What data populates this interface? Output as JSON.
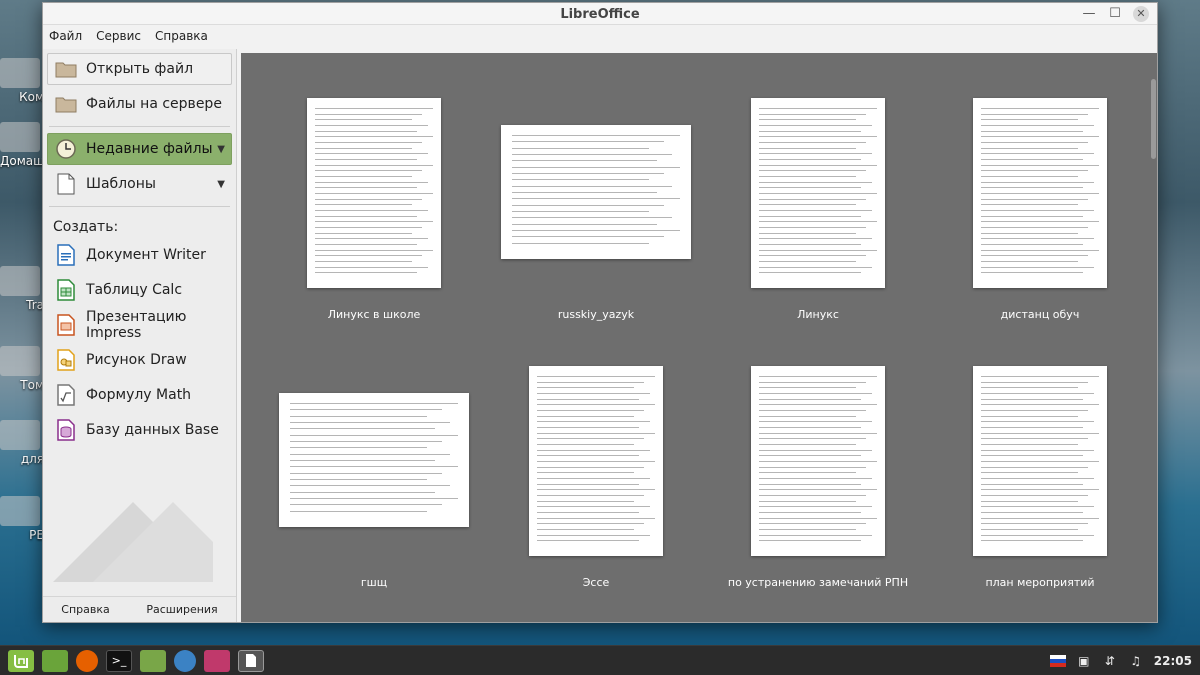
{
  "desktop": {
    "icons": [
      {
        "label": "Ком"
      },
      {
        "label": "Домаш"
      },
      {
        "label": "Tra"
      },
      {
        "label": "Том"
      },
      {
        "label": "для"
      },
      {
        "label": "PE"
      }
    ]
  },
  "window": {
    "title": "LibreOffice",
    "menu": [
      "Файл",
      "Сервис",
      "Справка"
    ]
  },
  "sidebar": {
    "open_file": "Открыть файл",
    "remote_files": "Файлы на сервере",
    "recent_files": "Недавние файлы",
    "templates": "Шаблоны",
    "create_label": "Создать:",
    "create_items": [
      {
        "label": "Документ Writer",
        "icon": "writer-icon",
        "color": "#2a6fba"
      },
      {
        "label": "Таблицу Calc",
        "icon": "calc-icon",
        "color": "#2e8b3a"
      },
      {
        "label": "Презентацию Impress",
        "icon": "impress-icon",
        "color": "#c8541f"
      },
      {
        "label": "Рисунок Draw",
        "icon": "draw-icon",
        "color": "#e2a21a"
      },
      {
        "label": "Формулу Math",
        "icon": "math-icon",
        "color": "#777777"
      },
      {
        "label": "Базу данных Base",
        "icon": "base-icon",
        "color": "#8a2f8c"
      }
    ],
    "help": "Справка",
    "extensions": "Расширения"
  },
  "recent_documents": [
    {
      "name": "Линукс в школе",
      "orientation": "portrait"
    },
    {
      "name": "russkiy_yazyk",
      "orientation": "landscape"
    },
    {
      "name": "Линукс",
      "orientation": "portrait"
    },
    {
      "name": "дистанц обуч",
      "orientation": "portrait"
    },
    {
      "name": "гшщ",
      "orientation": "landscape"
    },
    {
      "name": "Эссе",
      "orientation": "portrait"
    },
    {
      "name": "по устранению замечаний РПН",
      "orientation": "portrait"
    },
    {
      "name": "план мероприятий",
      "orientation": "portrait"
    }
  ],
  "taskbar": {
    "clock": "22:05",
    "colors": {
      "bar": "#2b2b2b",
      "mint": "#86be43"
    }
  }
}
